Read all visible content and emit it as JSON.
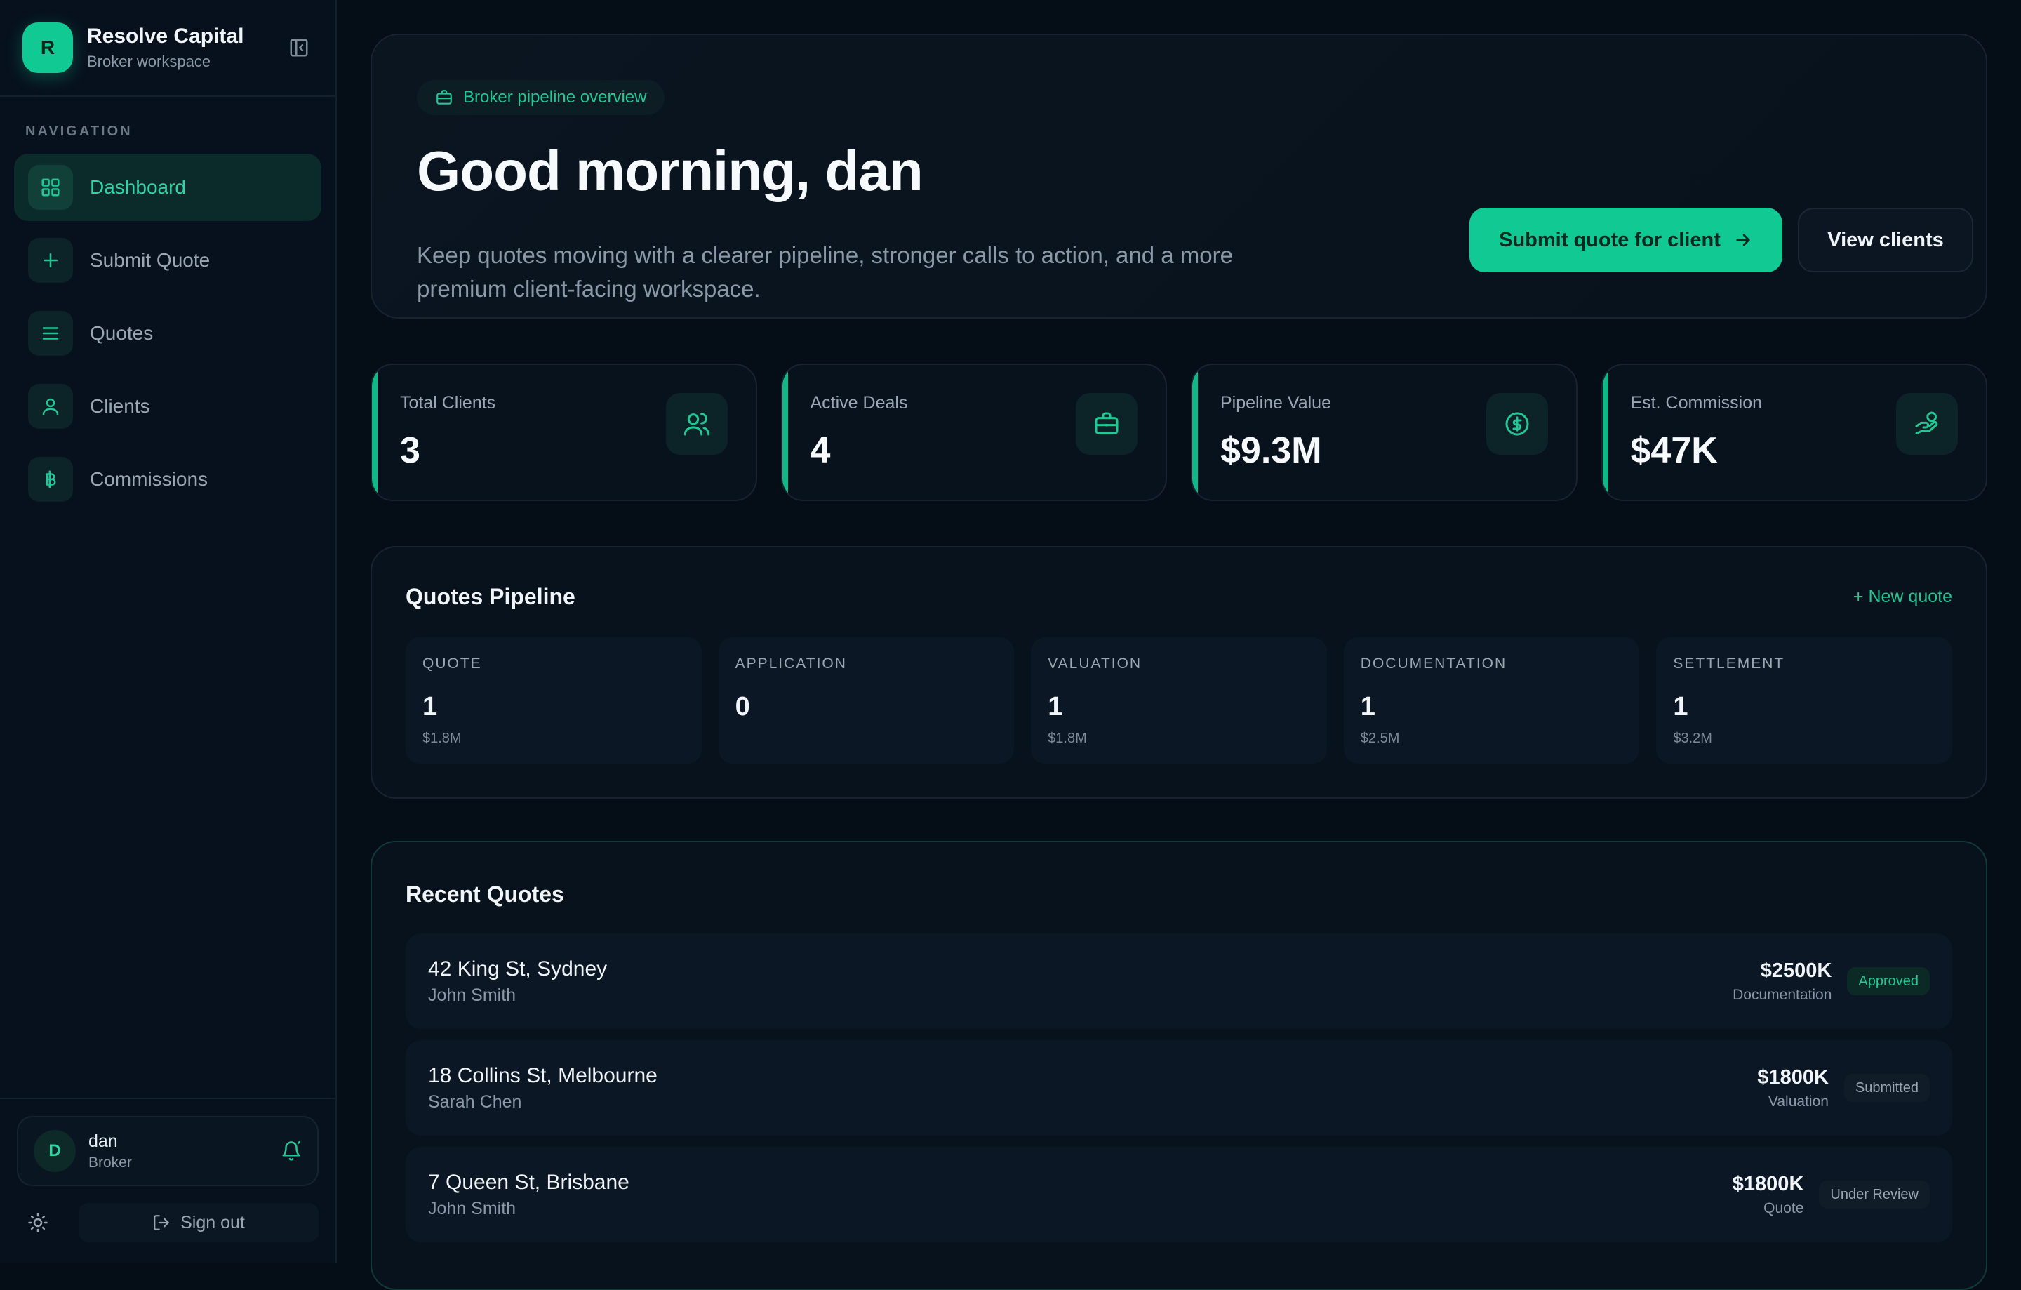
{
  "brand": {
    "initial": "R",
    "name": "Resolve Capital",
    "subtitle": "Broker workspace"
  },
  "sidebar": {
    "section_label": "NAVIGATION",
    "items": [
      {
        "label": "Dashboard",
        "icon": "grid-icon",
        "active": true
      },
      {
        "label": "Submit Quote",
        "icon": "plus-icon"
      },
      {
        "label": "Quotes",
        "icon": "list-icon"
      },
      {
        "label": "Clients",
        "icon": "user-icon"
      },
      {
        "label": "Commissions",
        "icon": "currency-icon"
      }
    ],
    "user": {
      "initial": "D",
      "name": "dan",
      "role": "Broker"
    },
    "signout_label": "Sign out"
  },
  "hero": {
    "chip": "Broker pipeline overview",
    "title": "Good morning, dan",
    "description": "Keep quotes moving with a clearer pipeline, stronger calls to action, and a more premium client-facing workspace.",
    "primary_button": "Submit quote for client",
    "secondary_button": "View clients"
  },
  "stats": [
    {
      "label": "Total Clients",
      "value": "3",
      "icon": "users-icon"
    },
    {
      "label": "Active Deals",
      "value": "4",
      "icon": "briefcase-icon"
    },
    {
      "label": "Pipeline Value",
      "value": "$9.3M",
      "icon": "dollar-circle-icon"
    },
    {
      "label": "Est. Commission",
      "value": "$47K",
      "icon": "hand-coins-icon"
    }
  ],
  "pipeline": {
    "title": "Quotes Pipeline",
    "new_quote": "+ New quote",
    "stages": [
      {
        "name": "QUOTE",
        "count": "1",
        "amount": "$1.8M"
      },
      {
        "name": "APPLICATION",
        "count": "0",
        "amount": ""
      },
      {
        "name": "VALUATION",
        "count": "1",
        "amount": "$1.8M"
      },
      {
        "name": "DOCUMENTATION",
        "count": "1",
        "amount": "$2.5M"
      },
      {
        "name": "SETTLEMENT",
        "count": "1",
        "amount": "$3.2M"
      }
    ]
  },
  "recent": {
    "title": "Recent Quotes",
    "quotes": [
      {
        "address": "42 King St, Sydney",
        "client": "John Smith",
        "amount": "$2500K",
        "stage": "Documentation",
        "status": "Approved"
      },
      {
        "address": "18 Collins St, Melbourne",
        "client": "Sarah Chen",
        "amount": "$1800K",
        "stage": "Valuation",
        "status": "Submitted"
      },
      {
        "address": "7 Queen St, Brisbane",
        "client": "John Smith",
        "amount": "$1800K",
        "stage": "Quote",
        "status": "Under Review"
      }
    ]
  },
  "colors": {
    "accent": "#10c993",
    "background": "#050d17",
    "panel": "#08121c"
  }
}
